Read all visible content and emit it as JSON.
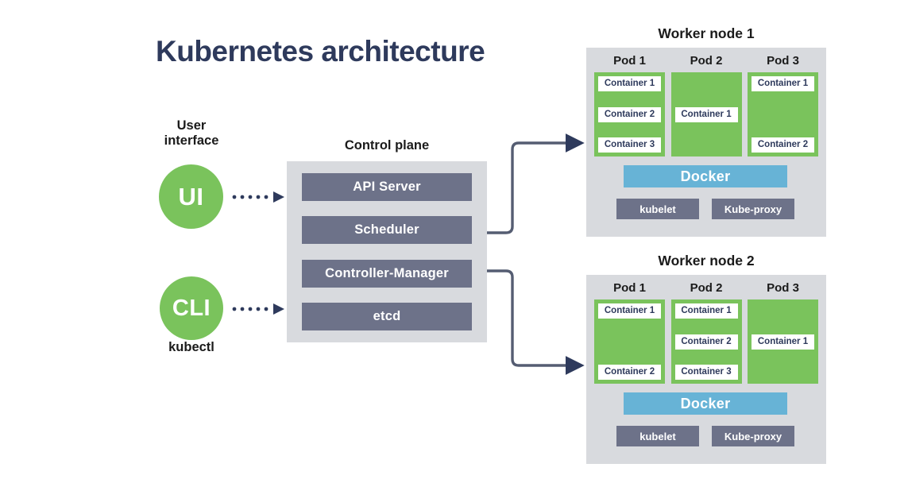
{
  "page": {
    "title": "Kubernetes architecture",
    "title_color": "#2e3a5c",
    "background": "#ffffff"
  },
  "colors": {
    "pod_green": "#7ac35c",
    "docker_blue": "#67b3d6",
    "slate": "#6d7289",
    "panel_gray": "#d8dade",
    "navy": "#2e3a5c"
  },
  "user_interface": {
    "caption": "User\ninterface",
    "ui_node_label": "UI",
    "cli_node_label": "CLI",
    "cli_caption": "kubectl",
    "arrow_ui_icon": "dotted-arrow-right-icon",
    "arrow_cli_icon": "dotted-arrow-right-icon"
  },
  "control_plane": {
    "label": "Control plane",
    "components": [
      {
        "label": "API Server"
      },
      {
        "label": "Scheduler"
      },
      {
        "label": "Controller-Manager"
      },
      {
        "label": "etcd"
      }
    ]
  },
  "worker_nodes": [
    {
      "title": "Worker node 1",
      "pods": [
        {
          "label": "Pod 1",
          "layout": "justify-between",
          "containers": [
            "Container 1",
            "Container 2",
            "Container 3"
          ]
        },
        {
          "label": "Pod 2",
          "layout": "justify-center",
          "containers": [
            "Container 1"
          ]
        },
        {
          "label": "Pod 3",
          "layout": "justify-between",
          "containers": [
            "Container 1",
            "Container 2"
          ]
        }
      ],
      "runtime": "Docker",
      "services": [
        "kubelet",
        "Kube-proxy"
      ]
    },
    {
      "title": "Worker node 2",
      "pods": [
        {
          "label": "Pod 1",
          "layout": "justify-between",
          "containers": [
            "Container 1",
            "Container 2"
          ]
        },
        {
          "label": "Pod 2",
          "layout": "justify-between",
          "containers": [
            "Container 1",
            "Container 2",
            "Container 3"
          ]
        },
        {
          "label": "Pod 3",
          "layout": "justify-center",
          "containers": [
            "Container 1"
          ]
        }
      ],
      "runtime": "Docker",
      "services": [
        "kubelet",
        "Kube-proxy"
      ]
    }
  ],
  "connectors": [
    {
      "name": "scheduler-to-worker-node-1",
      "from": "Scheduler",
      "to": "Worker node 1"
    },
    {
      "name": "controller-manager-to-worker-node-2",
      "from": "Controller-Manager",
      "to": "Worker node 2"
    }
  ]
}
